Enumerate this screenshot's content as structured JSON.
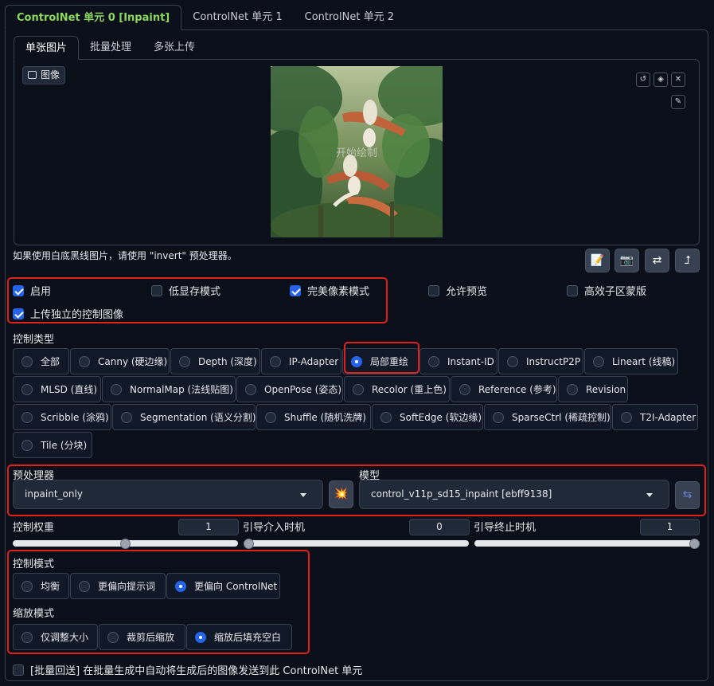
{
  "unit_tabs": [
    "ControlNet 单元 0 [Inpaint]",
    "ControlNet 单元 1",
    "ControlNet 单元 2"
  ],
  "input_tabs": [
    "单张图片",
    "批量处理",
    "多张上传"
  ],
  "image": {
    "label": "图像",
    "caption": "开始绘制"
  },
  "image_tools": [
    "↺",
    "◈",
    "✕",
    "✎"
  ],
  "hint": "如果使用白底黑线图片，请使用 \"invert\" 预处理器。",
  "action_buttons": [
    "📝",
    "📷",
    "⇄",
    "⮥"
  ],
  "options": {
    "enable": "启用",
    "low_vram": "低显存模式",
    "pixel_perfect": "完美像素模式",
    "allow_preview": "允许预览",
    "effective_region": "高效子区蒙版",
    "upload_independent": "上传独立的控制图像"
  },
  "control_type": {
    "label": "控制类型",
    "items": [
      "全部",
      "Canny (硬边缘)",
      "Depth (深度)",
      "IP-Adapter",
      "局部重绘",
      "Instant-ID",
      "InstructP2P",
      "Lineart (线稿)",
      "MLSD (直线)",
      "NormalMap (法线贴图)",
      "OpenPose (姿态)",
      "Recolor (重上色)",
      "Reference (参考)",
      "Revision",
      "Scribble (涂鸦)",
      "Segmentation (语义分割)",
      "Shuffle (随机洗牌)",
      "SoftEdge (软边缘)",
      "SparseCtrl (稀疏控制)",
      "T2I-Adapter",
      "Tile (分块)"
    ],
    "selected": "局部重绘"
  },
  "preprocessor": {
    "label": "预处理器",
    "value": "inpaint_only",
    "run_icon": "💥"
  },
  "model": {
    "label": "模型",
    "value": "control_v11p_sd15_inpaint [ebff9138]",
    "refresh_icon": "⇆"
  },
  "sliders": {
    "weight": {
      "label": "控制权重",
      "value": "1",
      "fraction": 0.5
    },
    "start": {
      "label": "引导介入时机",
      "value": "0",
      "fraction": 0.0
    },
    "end": {
      "label": "引导终止时机",
      "value": "1",
      "fraction": 1.0
    }
  },
  "control_mode": {
    "label": "控制模式",
    "items": [
      "均衡",
      "更偏向提示词",
      "更偏向 ControlNet"
    ],
    "selected": "更偏向 ControlNet"
  },
  "resize_mode": {
    "label": "缩放模式",
    "items": [
      "仅调整大小",
      "裁剪后缩放",
      "缩放后填充空白"
    ],
    "selected": "缩放后填充空白"
  },
  "loopback": "[批量回送] 在批量生成中自动将生成后的图像发送到此 ControlNet 单元",
  "colors": {
    "accent": "#2563eb",
    "active_tab": "#8bd95e",
    "highlight": "#e0201b",
    "background": "#0b0f19"
  }
}
